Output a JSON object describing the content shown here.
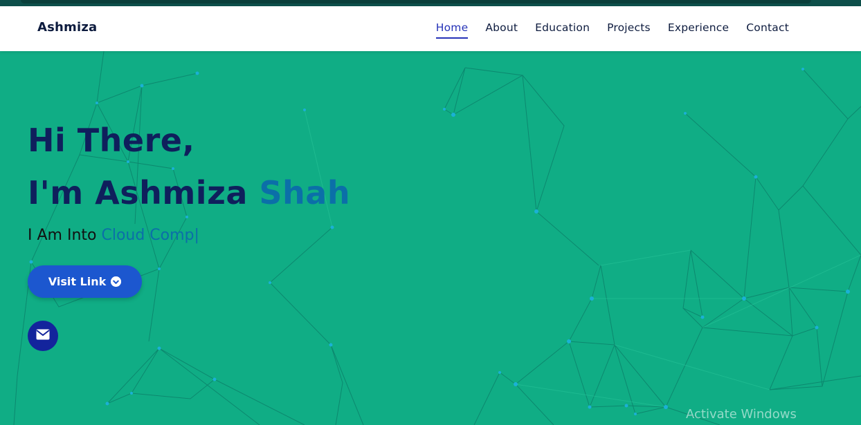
{
  "nav": {
    "brand": "Ashmiza",
    "links": [
      {
        "label": "Home",
        "active": true
      },
      {
        "label": "About"
      },
      {
        "label": "Education"
      },
      {
        "label": "Projects"
      },
      {
        "label": "Experience"
      },
      {
        "label": "Contact"
      }
    ]
  },
  "hero": {
    "greeting": "Hi There,",
    "name_prefix": "I'm Ashmiza ",
    "name_accent": "Shah",
    "typing_prefix": "I Am Into ",
    "typing_text": "Cloud Comp",
    "cursor": "|",
    "button_label": "Visit Link",
    "button_icon": "chevron-circle-down-icon",
    "mail_icon": "envelope-icon"
  },
  "watermark": "Activate Windows",
  "colors": {
    "background": "#10ad85",
    "heading": "#0f1f5c",
    "accent": "#0b6fa8",
    "button": "#1c57cf",
    "mail_button": "#13249c",
    "nav_active": "#2532b8"
  }
}
